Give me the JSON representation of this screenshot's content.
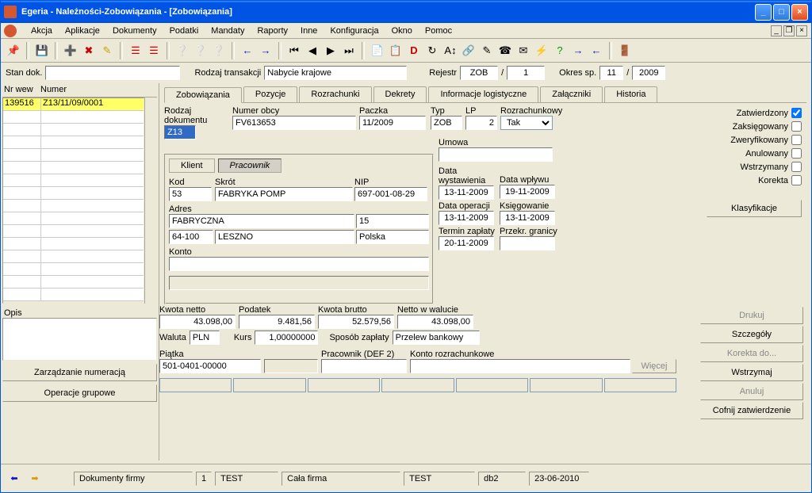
{
  "title": "Egeria - Należności-Zobowiązania - [Zobowiązania]",
  "menu": [
    "Akcja",
    "Aplikacje",
    "Dokumenty",
    "Podatki",
    "Mandaty",
    "Raporty",
    "Inne",
    "Konfiguracja",
    "Okno",
    "Pomoc"
  ],
  "filter": {
    "stan_lbl": "Stan dok.",
    "stan_val": "",
    "rodzaj_lbl": "Rodzaj transakcji",
    "rodzaj_val": "Nabycie krajowe",
    "rejestr_lbl": "Rejestr",
    "rejestr_val": "ZOB",
    "sep": "/",
    "rejestr_num": "1",
    "okres_lbl": "Okres sp.",
    "okres_m": "11",
    "okres_y": "2009"
  },
  "list": {
    "hdr1": "Nr wew",
    "hdr2": "Numer",
    "rows": [
      {
        "c1": "139516",
        "c2": "Z13/11/09/0001"
      }
    ]
  },
  "opis_lbl": "Opis",
  "btn_num": "Zarządzanie numeracją",
  "btn_grp": "Operacje grupowe",
  "tabs": [
    "Zobowiązania",
    "Pozycje",
    "Rozrachunki",
    "Dekrety",
    "Informacje logistyczne",
    "Załączniki",
    "Historia"
  ],
  "doc": {
    "rodzaj_lbl": "Rodzaj dokumentu",
    "rodzaj_val": "Z13",
    "obcy_lbl": "Numer obcy",
    "obcy_val": "FV613653",
    "paczka_lbl": "Paczka",
    "paczka_val": "11/2009",
    "typ_lbl": "Typ",
    "typ_val": "ZOB",
    "lp_lbl": "LP",
    "lp_val": "2",
    "rozr_lbl": "Rozrachunkowy",
    "rozr_val": "Tak"
  },
  "status": {
    "zatw": "Zatwierdzony",
    "zaks": "Zaksięgowany",
    "zwer": "Zweryfikowany",
    "anul": "Anulowany",
    "wstr": "Wstrzymany",
    "kor": "Korekta",
    "klas_btn": "Klasyfikacje"
  },
  "klient": {
    "t1": "Klient",
    "t2": "Pracownik",
    "kod_lbl": "Kod",
    "kod_val": "53",
    "skrot_lbl": "Skrót",
    "skrot_val": "FABRYKA POMP",
    "nip_lbl": "NIP",
    "nip_val": "697-001-08-29",
    "adres_lbl": "Adres",
    "adr1": "FABRYCZNA",
    "adr2": "15",
    "adr3": "64-100",
    "adr4": "LESZNO",
    "adr5": "Polska",
    "konto_lbl": "Konto"
  },
  "dates": {
    "umowa_lbl": "Umowa",
    "wyst_lbl": "Data\nwystawienia",
    "wplyw_lbl": "Data wpływu",
    "wyst_val": "13-11-2009",
    "wplyw_val": "19-11-2009",
    "oper_lbl": "Data operacji",
    "ksieg_lbl": "Księgowanie",
    "oper_val": "13-11-2009",
    "ksieg_val": "13-11-2009",
    "termin_lbl": "Termin zapłaty",
    "przekr_lbl": "Przekr. granicy",
    "termin_val": "20-11-2009"
  },
  "sum": {
    "netto_lbl": "Kwota netto",
    "netto_val": "43.098,00",
    "pod_lbl": "Podatek",
    "pod_val": "9.481,56",
    "brutto_lbl": "Kwota brutto",
    "brutto_val": "52.579,56",
    "nwal_lbl": "Netto w walucie",
    "nwal_val": "43.098,00",
    "waluta_lbl": "Waluta",
    "waluta_val": "PLN",
    "kurs_lbl": "Kurs",
    "kurs_val": "1,00000000",
    "spos_lbl": "Sposób zapłaty",
    "spos_val": "Przelew bankowy",
    "piatka_lbl": "Piątka",
    "piatka_val": "501-0401-00000",
    "prac_lbl": "Pracownik (DEF 2)",
    "konto_lbl": "Konto rozrachunkowe",
    "wiecej": "Więcej"
  },
  "actions": {
    "drukuj": "Drukuj",
    "szcz": "Szczegóły",
    "korekta": "Korekta do...",
    "wstrzymaj": "Wstrzymaj",
    "anuluj": "Anuluj",
    "cofnij": "Cofnij zatwierdzenie"
  },
  "statusbar": {
    "dokfirm": "Dokumenty firmy",
    "one": "1",
    "test1": "TEST",
    "calafirma": "Cała firma",
    "test2": "TEST",
    "db": "db2",
    "date": "23-06-2010"
  }
}
